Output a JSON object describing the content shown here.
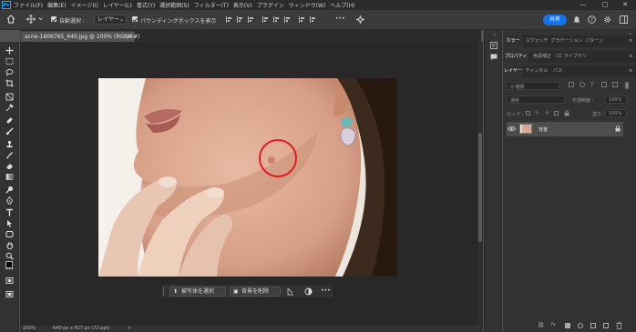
{
  "app": {
    "logo": "Ps"
  },
  "menu": [
    "ファイル(F)",
    "編集(E)",
    "イメージ(I)",
    "レイヤー(L)",
    "書式(Y)",
    "選択範囲(S)",
    "フィルター(T)",
    "表示(V)",
    "プラグイン",
    "ウィンドウ(W)",
    "ヘルプ(H)"
  ],
  "window_controls": {
    "minimize": "—",
    "maximize": "□",
    "close": "✕"
  },
  "options": {
    "auto_select": "自動選択 :",
    "layer_select": "レイヤー",
    "bounding_box": "バウンディングボックスを表示",
    "more": "•••",
    "share": "共有"
  },
  "document": {
    "tab": "acne-1606765_640.jpg @ 100% (RGB/8#)",
    "close": "×"
  },
  "context_bar": {
    "select_subject": "被写体を選択",
    "remove_bg": "背景を削除",
    "more": "•••"
  },
  "status": {
    "zoom": "100%",
    "info": "640 px x 427 px (72 ppi)",
    "arrow": ">"
  },
  "panels": {
    "color_tabs": [
      "カラー",
      "スウォッチ",
      "グラデーション",
      "パターン"
    ],
    "props_tabs": [
      "プロパティ",
      "色調補正",
      "CC ライブラリ"
    ],
    "layer_tabs": [
      "レイヤー",
      "チャンネル",
      "パス"
    ],
    "kind_search": "Q 種類",
    "blend_mode": "通常",
    "opacity_label": "不透明度 :",
    "opacity_value": "100%",
    "lock_label": "ロック :",
    "fill_label": "塗り :",
    "fill_value": "100%",
    "layer_name": "背景"
  },
  "colors": {
    "accent": "#1473e6",
    "circle": "#e11b22"
  },
  "icons": [
    "home-icon",
    "move-icon",
    "chevron-down-icon",
    "bell-icon",
    "help-icon",
    "gear-icon",
    "search-icon",
    "eye-icon",
    "lock-icon",
    "trash-icon"
  ]
}
